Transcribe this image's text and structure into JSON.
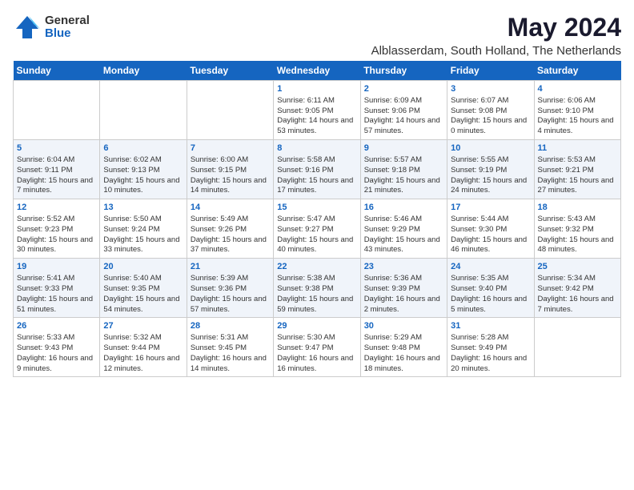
{
  "logo": {
    "general": "General",
    "blue": "Blue"
  },
  "title": "May 2024",
  "subtitle": "Alblasserdam, South Holland, The Netherlands",
  "headers": [
    "Sunday",
    "Monday",
    "Tuesday",
    "Wednesday",
    "Thursday",
    "Friday",
    "Saturday"
  ],
  "weeks": [
    [
      {
        "day": "",
        "data": ""
      },
      {
        "day": "",
        "data": ""
      },
      {
        "day": "",
        "data": ""
      },
      {
        "day": "1",
        "data": "Sunrise: 6:11 AM\nSunset: 9:05 PM\nDaylight: 14 hours and 53 minutes."
      },
      {
        "day": "2",
        "data": "Sunrise: 6:09 AM\nSunset: 9:06 PM\nDaylight: 14 hours and 57 minutes."
      },
      {
        "day": "3",
        "data": "Sunrise: 6:07 AM\nSunset: 9:08 PM\nDaylight: 15 hours and 0 minutes."
      },
      {
        "day": "4",
        "data": "Sunrise: 6:06 AM\nSunset: 9:10 PM\nDaylight: 15 hours and 4 minutes."
      }
    ],
    [
      {
        "day": "5",
        "data": "Sunrise: 6:04 AM\nSunset: 9:11 PM\nDaylight: 15 hours and 7 minutes."
      },
      {
        "day": "6",
        "data": "Sunrise: 6:02 AM\nSunset: 9:13 PM\nDaylight: 15 hours and 10 minutes."
      },
      {
        "day": "7",
        "data": "Sunrise: 6:00 AM\nSunset: 9:15 PM\nDaylight: 15 hours and 14 minutes."
      },
      {
        "day": "8",
        "data": "Sunrise: 5:58 AM\nSunset: 9:16 PM\nDaylight: 15 hours and 17 minutes."
      },
      {
        "day": "9",
        "data": "Sunrise: 5:57 AM\nSunset: 9:18 PM\nDaylight: 15 hours and 21 minutes."
      },
      {
        "day": "10",
        "data": "Sunrise: 5:55 AM\nSunset: 9:19 PM\nDaylight: 15 hours and 24 minutes."
      },
      {
        "day": "11",
        "data": "Sunrise: 5:53 AM\nSunset: 9:21 PM\nDaylight: 15 hours and 27 minutes."
      }
    ],
    [
      {
        "day": "12",
        "data": "Sunrise: 5:52 AM\nSunset: 9:23 PM\nDaylight: 15 hours and 30 minutes."
      },
      {
        "day": "13",
        "data": "Sunrise: 5:50 AM\nSunset: 9:24 PM\nDaylight: 15 hours and 33 minutes."
      },
      {
        "day": "14",
        "data": "Sunrise: 5:49 AM\nSunset: 9:26 PM\nDaylight: 15 hours and 37 minutes."
      },
      {
        "day": "15",
        "data": "Sunrise: 5:47 AM\nSunset: 9:27 PM\nDaylight: 15 hours and 40 minutes."
      },
      {
        "day": "16",
        "data": "Sunrise: 5:46 AM\nSunset: 9:29 PM\nDaylight: 15 hours and 43 minutes."
      },
      {
        "day": "17",
        "data": "Sunrise: 5:44 AM\nSunset: 9:30 PM\nDaylight: 15 hours and 46 minutes."
      },
      {
        "day": "18",
        "data": "Sunrise: 5:43 AM\nSunset: 9:32 PM\nDaylight: 15 hours and 48 minutes."
      }
    ],
    [
      {
        "day": "19",
        "data": "Sunrise: 5:41 AM\nSunset: 9:33 PM\nDaylight: 15 hours and 51 minutes."
      },
      {
        "day": "20",
        "data": "Sunrise: 5:40 AM\nSunset: 9:35 PM\nDaylight: 15 hours and 54 minutes."
      },
      {
        "day": "21",
        "data": "Sunrise: 5:39 AM\nSunset: 9:36 PM\nDaylight: 15 hours and 57 minutes."
      },
      {
        "day": "22",
        "data": "Sunrise: 5:38 AM\nSunset: 9:38 PM\nDaylight: 15 hours and 59 minutes."
      },
      {
        "day": "23",
        "data": "Sunrise: 5:36 AM\nSunset: 9:39 PM\nDaylight: 16 hours and 2 minutes."
      },
      {
        "day": "24",
        "data": "Sunrise: 5:35 AM\nSunset: 9:40 PM\nDaylight: 16 hours and 5 minutes."
      },
      {
        "day": "25",
        "data": "Sunrise: 5:34 AM\nSunset: 9:42 PM\nDaylight: 16 hours and 7 minutes."
      }
    ],
    [
      {
        "day": "26",
        "data": "Sunrise: 5:33 AM\nSunset: 9:43 PM\nDaylight: 16 hours and 9 minutes."
      },
      {
        "day": "27",
        "data": "Sunrise: 5:32 AM\nSunset: 9:44 PM\nDaylight: 16 hours and 12 minutes."
      },
      {
        "day": "28",
        "data": "Sunrise: 5:31 AM\nSunset: 9:45 PM\nDaylight: 16 hours and 14 minutes."
      },
      {
        "day": "29",
        "data": "Sunrise: 5:30 AM\nSunset: 9:47 PM\nDaylight: 16 hours and 16 minutes."
      },
      {
        "day": "30",
        "data": "Sunrise: 5:29 AM\nSunset: 9:48 PM\nDaylight: 16 hours and 18 minutes."
      },
      {
        "day": "31",
        "data": "Sunrise: 5:28 AM\nSunset: 9:49 PM\nDaylight: 16 hours and 20 minutes."
      },
      {
        "day": "",
        "data": ""
      }
    ]
  ]
}
